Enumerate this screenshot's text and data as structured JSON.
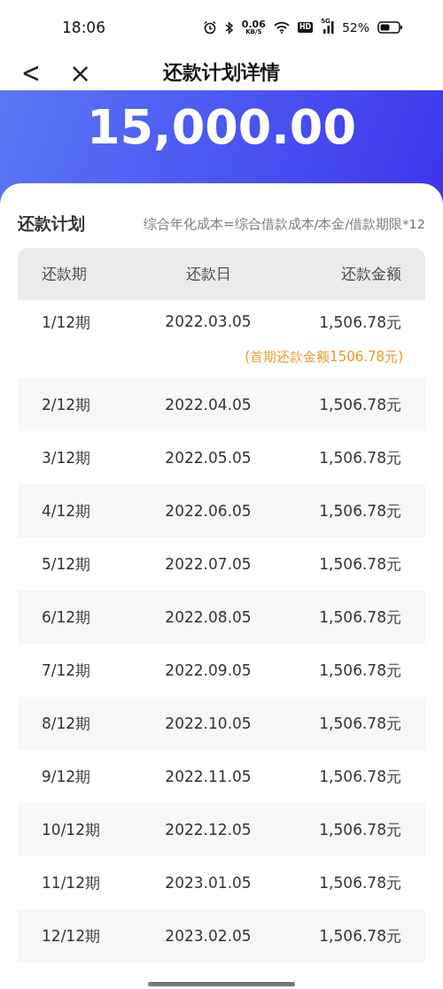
{
  "status_bar": {
    "time": "18:06",
    "net_speed": "0.06",
    "net_unit": "KB/S",
    "hd": "HD",
    "network": "5G",
    "battery": "52%"
  },
  "nav": {
    "back": "<",
    "close": "×",
    "title": "还款计划详情"
  },
  "amount": "15,000.00",
  "plan": {
    "title": "还款计划",
    "formula": "综合年化成本=综合借款成本/本金/借款期限*12",
    "columns": [
      "还款期",
      "还款日",
      "还款金额"
    ],
    "rows": [
      {
        "period": "1/12期",
        "date": "2022.03.05",
        "amount": "1,506.78元",
        "note": "(首期还款金额1506.78元)"
      },
      {
        "period": "2/12期",
        "date": "2022.04.05",
        "amount": "1,506.78元"
      },
      {
        "period": "3/12期",
        "date": "2022.05.05",
        "amount": "1,506.78元"
      },
      {
        "period": "4/12期",
        "date": "2022.06.05",
        "amount": "1,506.78元"
      },
      {
        "period": "5/12期",
        "date": "2022.07.05",
        "amount": "1,506.78元"
      },
      {
        "period": "6/12期",
        "date": "2022.08.05",
        "amount": "1,506.78元"
      },
      {
        "period": "7/12期",
        "date": "2022.09.05",
        "amount": "1,506.78元"
      },
      {
        "period": "8/12期",
        "date": "2022.10.05",
        "amount": "1,506.78元"
      },
      {
        "period": "9/12期",
        "date": "2022.11.05",
        "amount": "1,506.78元"
      },
      {
        "period": "10/12期",
        "date": "2022.12.05",
        "amount": "1,506.78元"
      },
      {
        "period": "11/12期",
        "date": "2023.01.05",
        "amount": "1,506.78元"
      },
      {
        "period": "12/12期",
        "date": "2023.02.05",
        "amount": "1,506.78元"
      }
    ]
  }
}
